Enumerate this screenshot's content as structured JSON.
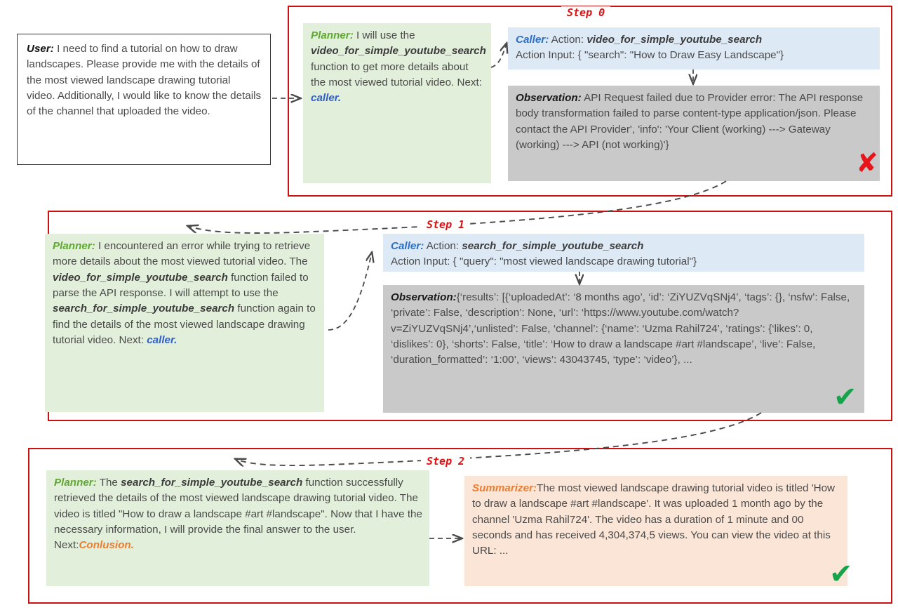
{
  "diagram": {
    "title": "Agent pipeline trace: Planner / Caller / Observation / Summarizer",
    "accent_red": "#cc1111",
    "planner_green": "#e2efda",
    "caller_blue": "#dde9f5",
    "observation_gray": "#c9c9c9",
    "summarizer_peach": "#fbe5d6"
  },
  "user": {
    "label": "User:",
    "text": " I need to find a tutorial on how to draw landscapes. Please provide me with the details of the most viewed landscape drawing tutorial video. Additionally, I would like to know the details of the channel that uploaded the video."
  },
  "steps": [
    {
      "label": "Step 0",
      "planner": {
        "label": "Planner:",
        "text_1": " I will use the ",
        "function": "video_for_simple_youtube_search",
        "text_2": " function to get more details about the most  viewed tutorial video. Next: ",
        "next": "caller."
      },
      "caller": {
        "label": "Caller:",
        "action_prefix": " Action: ",
        "action": "video_for_simple_youtube_search",
        "action_input": "Action Input: { \"search\": \"How to Draw Easy Landscape\"}"
      },
      "observation": {
        "label": "Observation:",
        "text": "  API Request failed due to Provider error: The API response body transformation failed to parse content-type application/json. Please contact the API Provider', 'info': 'Your Client (working) ---> Gateway (working) ---> API (not working)'}",
        "status_mark": "✘",
        "status": "failure"
      }
    },
    {
      "label": "Step 1",
      "planner": {
        "label": "Planner:",
        "text_1": " I encountered an error while trying to retrieve more details about the most viewed tutorial video. The ",
        "function": "video_for_simple_youtube_search",
        "text_2": " function failed to parse the API response. I will attempt to use the ",
        "function_2": "search_for_simple_youtube_search",
        "text_3": " function again to find the details of the most viewed landscape drawing tutorial video. Next: ",
        "next": "caller."
      },
      "caller": {
        "label": "Caller:",
        "action_prefix": " Action: ",
        "action": "search_for_simple_youtube_search",
        "action_input": "Action Input: { \"query\": \"most viewed landscape drawing tutorial\"}"
      },
      "observation": {
        "label": "Observation:",
        "text": "{‘results’: [{‘uploadedAt’: ‘8 months ago’, ‘id’: ‘ZiYUZVqSNj4’, ‘tags’: {}, ‘nsfw’: False, ‘private’: False, ‘description’: None, ‘url’: ‘https://www.youtube.com/watch? v=ZiYUZVqSNj4’,‘unlisted’:  False, ‘channel’: {‘name’: ‘Uzma Rahil724’, ‘ratings’: {‘likes’: 0, ‘dislikes’: 0}, ‘shorts’: False, ‘title’: ‘How to draw a landscape #art #landscape’, ‘live’: False, ‘duration_formatted’: ‘1:00’, ‘views’: 43043745, ‘type’: ‘video’}, ...",
        "status_mark": "✔",
        "status": "success"
      }
    },
    {
      "label": "Step 2",
      "planner": {
        "label": "Planner:",
        "text_1": " The ",
        "function": "search_for_simple_youtube_search",
        "text_2": " function successfully  retrieved the details of the most viewed landscape drawing tutorial video. The video is titled \"How to draw a landscape #art #landscape\". Now that I have the necessary information, I will provide the final answer to the user. Next:",
        "next": "Conlusion."
      },
      "summarizer": {
        "label": "Summarizer:",
        "text": "The most viewed landscape drawing tutorial video is titled 'How to draw a landscape #art #landscape'. It was uploaded 1 month ago by the channel 'Uzma Rahil724'. The video has a duration of 1 minute and 00 seconds and has received 4,304,374,5  views. You can view the video at this URL: ...",
        "status_mark": "✔",
        "status": "success"
      }
    }
  ]
}
